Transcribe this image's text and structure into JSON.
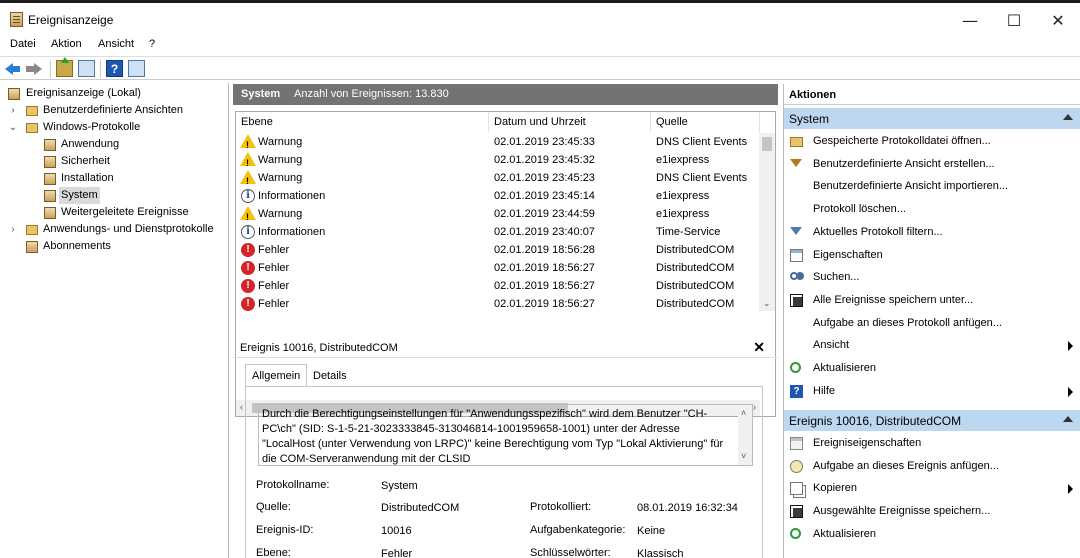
{
  "window": {
    "title": "Ereignisanzeige",
    "controls": {
      "minimize": "—",
      "maximize": "☐",
      "close": "✕"
    }
  },
  "menu": [
    "Datei",
    "Aktion",
    "Ansicht",
    "?"
  ],
  "toolbar": {
    "icons": [
      "back-arrow-icon",
      "forward-arrow-icon",
      "up-folder-icon",
      "show-hide-console-tree-icon",
      "help-icon",
      "show-hide-action-pane-icon"
    ]
  },
  "tree": {
    "items": [
      {
        "label": "Ereignisanzeige (Lokal)",
        "icon": "event-viewer-icon",
        "expander": ""
      },
      {
        "label": "Benutzerdefinierte Ansichten",
        "icon": "folder-icon",
        "expander": "›"
      },
      {
        "label": "Windows-Protokolle",
        "icon": "folder-icon",
        "expander": "⌄"
      },
      {
        "label": "Anwendung",
        "icon": "log-icon",
        "expander": ""
      },
      {
        "label": "Sicherheit",
        "icon": "log-icon",
        "expander": ""
      },
      {
        "label": "Installation",
        "icon": "log-icon",
        "expander": ""
      },
      {
        "label": "System",
        "icon": "log-icon",
        "expander": ""
      },
      {
        "label": "Weitergeleitete Ereignisse",
        "icon": "log-icon",
        "expander": ""
      },
      {
        "label": "Anwendungs- und Dienstprotokolle",
        "icon": "folder-icon",
        "expander": "›"
      },
      {
        "label": "Abonnements",
        "icon": "log-icon",
        "expander": ""
      }
    ]
  },
  "list": {
    "title": "System",
    "count_label": "Anzahl von Ereignissen: 13.830",
    "columns": [
      "Ebene",
      "Datum und Uhrzeit",
      "Quelle"
    ],
    "rows": [
      {
        "level": "Warnung",
        "type": "warn",
        "datetime": "02.01.2019 23:45:33",
        "source": "DNS Client Events"
      },
      {
        "level": "Warnung",
        "type": "warn",
        "datetime": "02.01.2019 23:45:32",
        "source": "e1iexpress"
      },
      {
        "level": "Warnung",
        "type": "warn",
        "datetime": "02.01.2019 23:45:23",
        "source": "DNS Client Events"
      },
      {
        "level": "Informationen",
        "type": "info",
        "datetime": "02.01.2019 23:45:14",
        "source": "e1iexpress"
      },
      {
        "level": "Warnung",
        "type": "warn",
        "datetime": "02.01.2019 23:44:59",
        "source": "e1iexpress"
      },
      {
        "level": "Informationen",
        "type": "info",
        "datetime": "02.01.2019 23:40:07",
        "source": "Time-Service"
      },
      {
        "level": "Fehler",
        "type": "err",
        "datetime": "02.01.2019 18:56:28",
        "source": "DistributedCOM"
      },
      {
        "level": "Fehler",
        "type": "err",
        "datetime": "02.01.2019 18:56:27",
        "source": "DistributedCOM"
      },
      {
        "level": "Fehler",
        "type": "err",
        "datetime": "02.01.2019 18:56:27",
        "source": "DistributedCOM"
      },
      {
        "level": "Fehler",
        "type": "err",
        "datetime": "02.01.2019 18:56:27",
        "source": "DistributedCOM"
      }
    ]
  },
  "detail": {
    "title": "Ereignis 10016, DistributedCOM",
    "close": "✕",
    "tabs": [
      "Allgemein",
      "Details"
    ],
    "description": "Durch die Berechtigungseinstellungen für \"Anwendungsspezifisch\" wird dem Benutzer \"CH-PC\\ch\" (SID: S-1-5-21-3023333845-313046814-1001959658-1001) unter der Adresse \"LocalHost (unter Verwendung von LRPC)\" keine Berechtigung vom Typ \"Lokal Aktivierung\" für die COM-Serveranwendung mit der CLSID",
    "props": {
      "log_name_label": "Protokollname:",
      "log_name": "System",
      "source_label": "Quelle:",
      "source": "DistributedCOM",
      "logged_label": "Protokolliert:",
      "logged": "08.01.2019 16:32:34",
      "event_id_label": "Ereignis-ID:",
      "event_id": "10016",
      "category_label": "Aufgabenkategorie:",
      "category": "Keine",
      "level_label": "Ebene:",
      "level": "Fehler",
      "keywords_label": "Schlüsselwörter:",
      "keywords": "Klassisch"
    }
  },
  "actions": {
    "title": "Aktionen",
    "section1": {
      "title": "System",
      "items": [
        {
          "label": "Gespeicherte Protokolldatei öffnen...",
          "icon": "open-saved-log-icon",
          "sub": false
        },
        {
          "label": "Benutzerdefinierte Ansicht erstellen...",
          "icon": "create-custom-view-icon",
          "sub": false
        },
        {
          "label": "Benutzerdefinierte Ansicht importieren...",
          "icon": "",
          "sub": false
        },
        {
          "label": "Protokoll löschen...",
          "icon": "",
          "sub": false
        },
        {
          "label": "Aktuelles Protokoll filtern...",
          "icon": "filter-icon",
          "sub": false
        },
        {
          "label": "Eigenschaften",
          "icon": "properties-icon",
          "sub": false
        },
        {
          "label": "Suchen...",
          "icon": "find-icon",
          "sub": false
        },
        {
          "label": "Alle Ereignisse speichern unter...",
          "icon": "save-icon",
          "sub": false
        },
        {
          "label": "Aufgabe an dieses Protokoll anfügen...",
          "icon": "",
          "sub": false
        },
        {
          "label": "Ansicht",
          "icon": "",
          "sub": true
        },
        {
          "label": "Aktualisieren",
          "icon": "refresh-icon",
          "sub": false
        },
        {
          "label": "Hilfe",
          "icon": "help-icon",
          "sub": true
        }
      ]
    },
    "section2": {
      "title": "Ereignis 10016, DistributedCOM",
      "items": [
        {
          "label": "Ereigniseigenschaften",
          "icon": "event-properties-icon",
          "sub": false
        },
        {
          "label": "Aufgabe an dieses Ereignis anfügen...",
          "icon": "attach-task-icon",
          "sub": false
        },
        {
          "label": "Kopieren",
          "icon": "copy-icon",
          "sub": true
        },
        {
          "label": "Ausgewählte Ereignisse speichern...",
          "icon": "save-icon",
          "sub": false
        },
        {
          "label": "Aktualisieren",
          "icon": "refresh-icon",
          "sub": false
        }
      ]
    }
  },
  "colors": {
    "list_header_bg": "#737373",
    "section_header_bg": "#bed7f0",
    "selection": "#d9d9d9",
    "error_red": "#d3252a",
    "warning_yellow": "#f4c10a"
  }
}
